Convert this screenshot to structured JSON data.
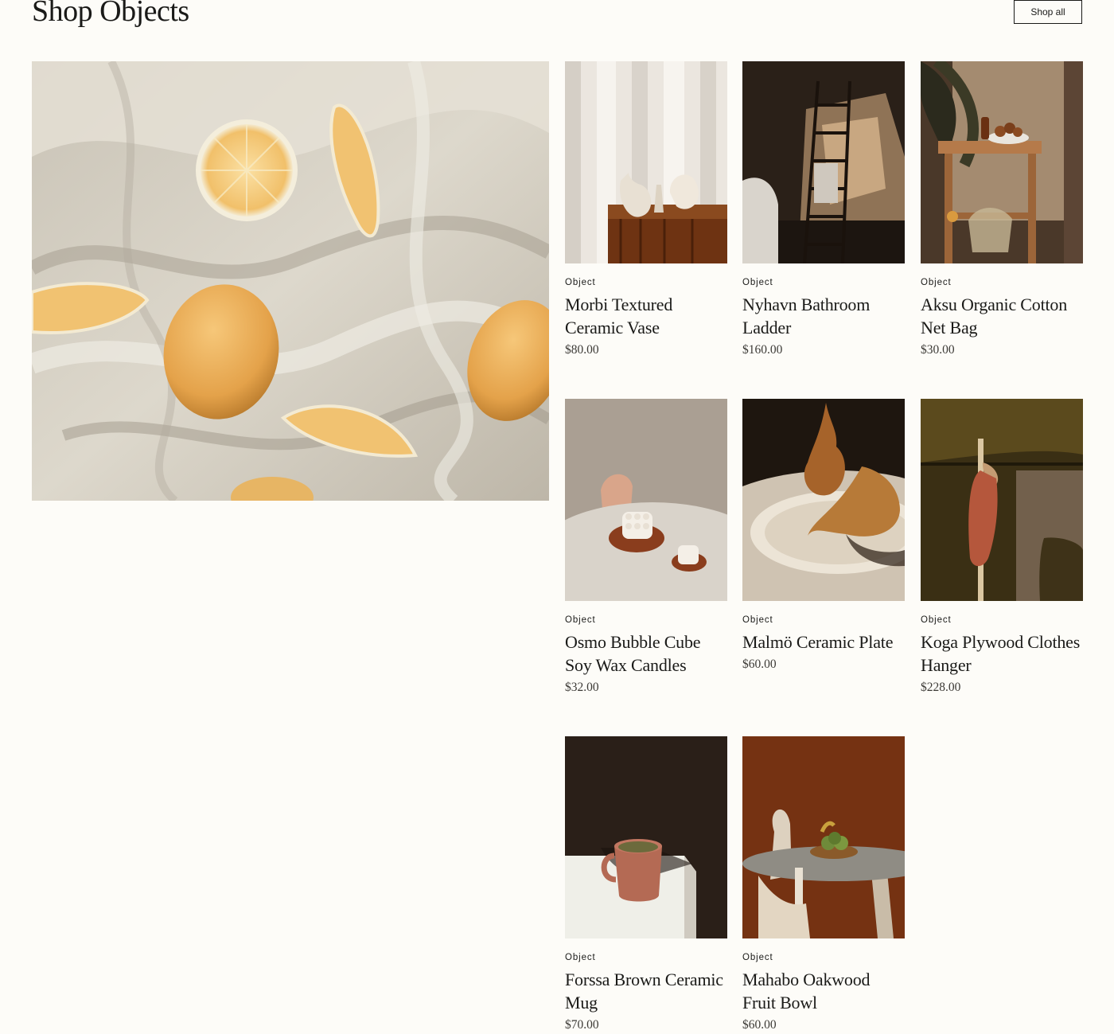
{
  "section": {
    "title": "Shop Objects",
    "shop_all_label": "Shop all"
  },
  "products": [
    {
      "category": "Object",
      "name": "Morbi Textured Ceramic Vase",
      "price": "$80.00"
    },
    {
      "category": "Object",
      "name": "Nyhavn Bathroom Ladder",
      "price": "$160.00"
    },
    {
      "category": "Object",
      "name": "Aksu Organic Cotton Net Bag",
      "price": "$30.00"
    },
    {
      "category": "Object",
      "name": "Osmo Bubble Cube Soy Wax Candles",
      "price": "$32.00"
    },
    {
      "category": "Object",
      "name": "Malmö Ceramic Plate",
      "price": "$60.00"
    },
    {
      "category": "Object",
      "name": "Koga Plywood Clothes Hanger",
      "price": "$228.00"
    },
    {
      "category": "Object",
      "name": "Forssa Brown Ceramic Mug",
      "price": "$70.00"
    },
    {
      "category": "Object",
      "name": "Mahabo Oakwood Fruit Bowl",
      "price": "$60.00"
    }
  ],
  "colors": {
    "background": "#fdfcf8",
    "text": "#1a1a18",
    "price_text": "#3c3a36"
  }
}
